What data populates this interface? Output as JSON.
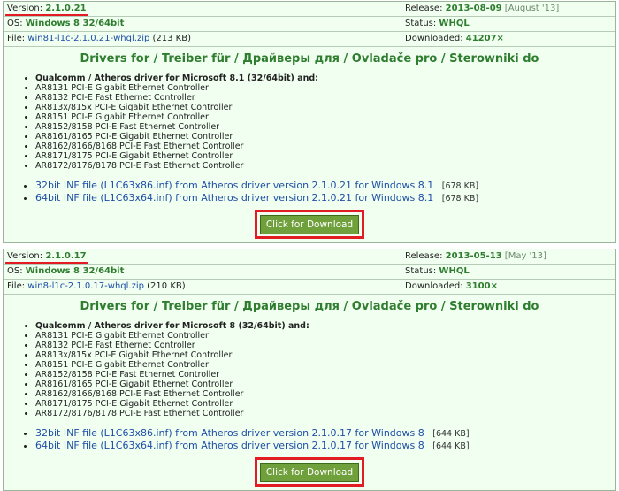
{
  "drivers": [
    {
      "version_label": "Version:",
      "version": "2.1.0.21",
      "release_label": "Release:",
      "release_date": "2013-08-09",
      "release_month": "[August '13]",
      "os_label": "OS:",
      "os": "Windows 8 32/64bit",
      "status_label": "Status:",
      "status": "WHQL",
      "file_label": "File:",
      "file_name": "win81-l1c-2.1.0.21-whql.zip",
      "file_size": "(213 KB)",
      "downloaded_label": "Downloaded:",
      "downloaded": "41207×",
      "title": "Drivers for / Treiber für / Драйверы для / Ovladače pro / Sterowniki do",
      "heading_item": "Qualcomm / Atheros driver for Microsoft 8.1 (32/64bit) and:",
      "devices": [
        "AR8131 PCI-E Gigabit Ethernet Controller",
        "AR8132 PCI-E Fast Ethernet Controller",
        "AR813x/815x PCI-E Gigabit Ethernet Controller",
        "AR8151 PCI-E Gigabit Ethernet Controller",
        "AR8152/8158 PCI-E Fast Ethernet Controller",
        "AR8161/8165 PCI-E Gigabit Ethernet Controller",
        "AR8162/8166/8168 PCI-E Fast Ethernet Controller",
        "AR8171/8175 PCI-E Gigabit Ethernet Controller",
        "AR8172/8176/8178 PCI-E Fast Ethernet Controller"
      ],
      "files": [
        {
          "text": "32bit INF file (L1C63x86.inf) from Atheros driver version 2.1.0.21 for Windows 8.1",
          "size": "[678 KB]"
        },
        {
          "text": "64bit INF file (L1C63x64.inf) from Atheros driver version 2.1.0.21 for Windows 8.1",
          "size": "[678 KB]"
        }
      ],
      "download_label": "Click for Download"
    },
    {
      "version_label": "Version:",
      "version": "2.1.0.17",
      "release_label": "Release:",
      "release_date": "2013-05-13",
      "release_month": "[May '13]",
      "os_label": "OS:",
      "os": "Windows 8 32/64bit",
      "status_label": "Status:",
      "status": "WHQL",
      "file_label": "File:",
      "file_name": "win8-l1c-2.1.0.17-whql.zip",
      "file_size": "(210 KB)",
      "downloaded_label": "Downloaded:",
      "downloaded": "3100×",
      "title": "Drivers for / Treiber für / Драйверы для / Ovladače pro / Sterowniki do",
      "heading_item": "Qualcomm / Atheros driver for Microsoft 8 (32/64bit) and:",
      "devices": [
        "AR8131 PCI-E Gigabit Ethernet Controller",
        "AR8132 PCI-E Fast Ethernet Controller",
        "AR813x/815x PCI-E Gigabit Ethernet Controller",
        "AR8151 PCI-E Gigabit Ethernet Controller",
        "AR8152/8158 PCI-E Fast Ethernet Controller",
        "AR8161/8165 PCI-E Gigabit Ethernet Controller",
        "AR8162/8166/8168 PCI-E Fast Ethernet Controller",
        "AR8171/8175 PCI-E Gigabit Ethernet Controller",
        "AR8172/8176/8178 PCI-E Fast Ethernet Controller"
      ],
      "files": [
        {
          "text": "32bit INF file (L1C63x86.inf) from Atheros driver version 2.1.0.17 for Windows 8",
          "size": "[644 KB]"
        },
        {
          "text": "64bit INF file (L1C63x64.inf) from Atheros driver version 2.1.0.17 for Windows 8",
          "size": "[644 KB]"
        }
      ],
      "download_label": "Click for Download"
    }
  ],
  "colors": {
    "accent_green": "#2f7d2f",
    "link_blue": "#1e4ea8",
    "highlight_red": "#e31b23",
    "button_green": "#6fa03b",
    "background": "#f0fff0"
  }
}
